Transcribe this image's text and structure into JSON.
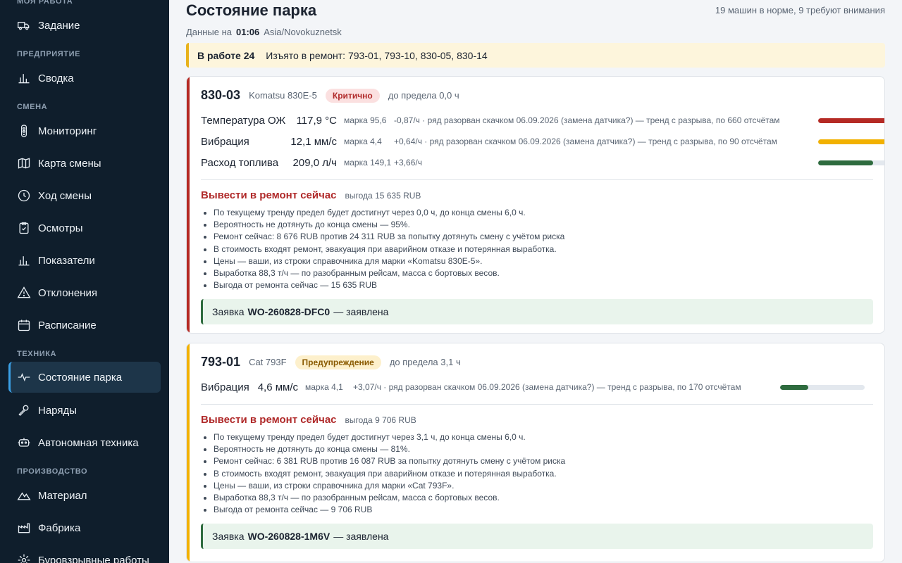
{
  "sidebar": {
    "sections": {
      "my_work": "МОЯ РАБОТА",
      "enterprise": "ПРЕДПРИЯТИЕ",
      "shift": "СМЕНА",
      "equipment": "ТЕХНИКА",
      "production": "ПРОИЗВОДСТВО"
    },
    "items": [
      {
        "label": "Задание",
        "icon": "truck-icon"
      },
      {
        "label": "Сводка",
        "icon": "bar-chart-icon"
      },
      {
        "label": "Мониторинг",
        "icon": "traffic-light-icon"
      },
      {
        "label": "Карта смены",
        "icon": "map-icon"
      },
      {
        "label": "Ход смены",
        "icon": "clock-icon"
      },
      {
        "label": "Осмотры",
        "icon": "clipboard-check-icon"
      },
      {
        "label": "Показатели",
        "icon": "bar-chart-icon"
      },
      {
        "label": "Отклонения",
        "icon": "warning-icon"
      },
      {
        "label": "Расписание",
        "icon": "calendar-icon"
      },
      {
        "label": "Состояние парка",
        "icon": "pulse-icon"
      },
      {
        "label": "Наряды",
        "icon": "wrench-icon"
      },
      {
        "label": "Автономная техника",
        "icon": "robot-icon"
      },
      {
        "label": "Материал",
        "icon": "mountain-icon"
      },
      {
        "label": "Фабрика",
        "icon": "factory-icon"
      },
      {
        "label": "Буровзрывные работы",
        "icon": "blast-icon"
      }
    ],
    "active_item": "Состояние парка"
  },
  "header": {
    "title": "Состояние парка",
    "summary": "19 машин в норме, 9 требуют внимания",
    "data_label": "Данные на",
    "data_time": "01:06",
    "timezone": "Asia/Novokuznetsk"
  },
  "banner": {
    "in_work": "В работе 24",
    "withdrawn": "Изъято в ремонт: 793-01, 793-10, 830-05, 830-14"
  },
  "colors": {
    "critical": "#b52a24",
    "warning": "#f2b100",
    "ok": "#2e6b3e",
    "accent": "#3aa0e6"
  },
  "cards": [
    {
      "id": "830-03",
      "model": "Komatsu 830E-5",
      "status": "Критично",
      "limit": "до предела 0,0 ч",
      "metrics": [
        {
          "name": "Температура ОЖ",
          "value": "117,9 °C",
          "mark": "марка 95,6",
          "note": "-0,87/ч · ряд разорван скачком 06.09.2026 (замена датчика?) — тренд с разрыва, по 660 отсчётам",
          "level": 1.0,
          "level_color": "#b52a24"
        },
        {
          "name": "Вибрация",
          "value": "12,1 мм/с",
          "mark": "марка 4,4",
          "note": "+0,64/ч · ряд разорван скачком 06.09.2026 (замена датчика?) — тренд с разрыва, по 90 отсчётам",
          "level": 0.88,
          "level_color": "#f2b100"
        },
        {
          "name": "Расход топлива",
          "value": "209,0 л/ч",
          "mark": "марка 149,1",
          "note": "+3,66/ч",
          "level": 0.65,
          "level_color": "#2e6b3e"
        }
      ],
      "action": "Вывести в ремонт сейчас",
      "benefit": "выгода 15 635 RUB",
      "bullets": [
        "По текущему тренду предел будет достигнут через 0,0 ч, до конца смены 6,0 ч.",
        "Вероятность не дотянуть до конца смены — 95%.",
        "Ремонт сейчас: 8 676 RUB против 24 311 RUB за попытку дотянуть смену с учётом риска",
        "В стоимость входят ремонт, эвакуация при аварийном отказе и потерянная выработка.",
        "Цены — ваши, из строки справочника для марки «Komatsu 830E-5».",
        "Выработка 88,3 т/ч — по разобранным рейсам, масса с бортовых весов.",
        "Выгода от ремонта сейчас — 15 635 RUB"
      ],
      "ticket_prefix": "Заявка",
      "ticket_id": "WO-260828-DFC0",
      "ticket_suffix": "— заявлена"
    },
    {
      "id": "793-01",
      "model": "Cat 793F",
      "status": "Предупреждение",
      "limit": "до предела 3,1 ч",
      "metrics": [
        {
          "name": "Вибрация",
          "value": "4,6 мм/с",
          "mark": "марка 4,1",
          "note": "+3,07/ч · ряд разорван скачком 06.09.2026 (замена датчика?) — тренд с разрыва, по 170 отсчётам",
          "level": 0.33,
          "level_color": "#2e6b3e"
        }
      ],
      "action": "Вывести в ремонт сейчас",
      "benefit": "выгода 9 706 RUB",
      "bullets": [
        "По текущему тренду предел будет достигнут через 3,1 ч, до конца смены 6,0 ч.",
        "Вероятность не дотянуть до конца смены — 81%.",
        "Ремонт сейчас: 6 381 RUB против 16 087 RUB за попытку дотянуть смену с учётом риска",
        "В стоимость входят ремонт, эвакуация при аварийном отказе и потерянная выработка.",
        "Цены — ваши, из строки справочника для марки «Cat 793F».",
        "Выработка 88,3 т/ч — по разобранным рейсам, масса с бортовых весов.",
        "Выгода от ремонта сейчас — 9 706 RUB"
      ],
      "ticket_prefix": "Заявка",
      "ticket_id": "WO-260828-1M6V",
      "ticket_suffix": "— заявлена"
    }
  ]
}
